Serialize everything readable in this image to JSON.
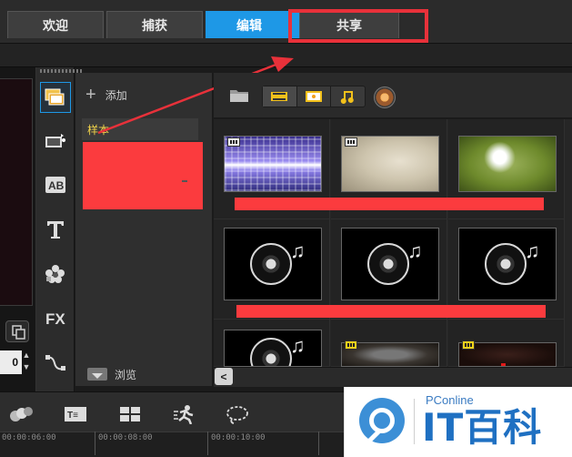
{
  "tabs": [
    {
      "label": "欢迎",
      "active": false
    },
    {
      "label": "捕获",
      "active": false
    },
    {
      "label": "编辑",
      "active": true
    },
    {
      "label": "共享",
      "active": false
    }
  ],
  "library": {
    "add_label": "添加",
    "sample_label": "样本",
    "browse_label": "浏览"
  },
  "preview": {
    "spinner_value": "0"
  },
  "timeline": {
    "ticks": [
      "00:00:06:00",
      "00:00:08:00",
      "00:00:10:00"
    ]
  },
  "watermark": {
    "sub": "PConline",
    "main": "IT百科"
  },
  "colors": {
    "accent": "#1e98e6",
    "highlight_red": "#e8313a",
    "sample_text": "#f0d24a"
  }
}
